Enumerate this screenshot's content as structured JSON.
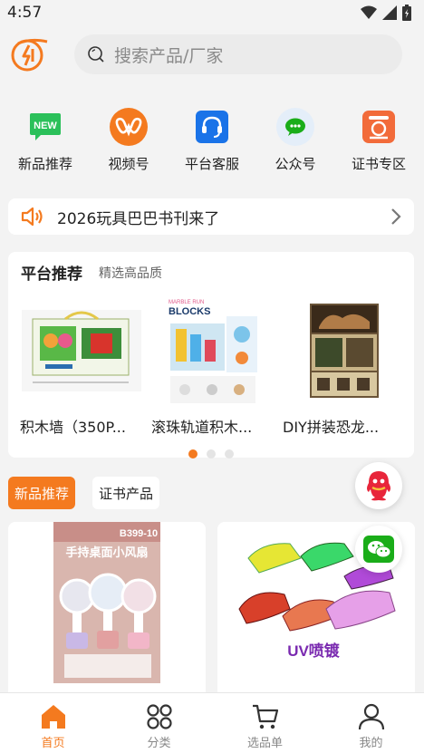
{
  "status_bar": {
    "time": "4:57"
  },
  "search": {
    "placeholder": "搜索产品/厂家"
  },
  "quick_links": [
    {
      "label": "新品推荐",
      "icon": "new-badge-icon",
      "badge": "NEW"
    },
    {
      "label": "视频号",
      "icon": "video-channel-icon"
    },
    {
      "label": "平台客服",
      "icon": "headset-icon"
    },
    {
      "label": "公众号",
      "icon": "wechat-icon"
    },
    {
      "label": "证书专区",
      "icon": "certificate-icon"
    }
  ],
  "notice": {
    "text": "2026玩具巴巴书刊来了"
  },
  "recommend": {
    "title": "平台推荐",
    "subtitle": "精选高品质",
    "products": [
      {
        "name": "积木墙（350P..."
      },
      {
        "name": "滚珠轨道积木..."
      },
      {
        "name": "DIY拼装恐龙..."
      }
    ]
  },
  "tabs": {
    "active": "新品推荐",
    "inactive": "证书产品"
  },
  "cards": [
    {
      "badge": "B399-10",
      "title": "手持桌面小风扇"
    },
    {
      "label": "UV喷镀"
    }
  ],
  "bottom_nav": [
    {
      "label": "首页",
      "icon": "home-icon",
      "active": true
    },
    {
      "label": "分类",
      "icon": "category-icon",
      "active": false
    },
    {
      "label": "选品单",
      "icon": "cart-icon",
      "active": false
    },
    {
      "label": "我的",
      "icon": "user-icon",
      "active": false
    }
  ],
  "colors": {
    "accent": "#f47a1f",
    "blue": "#1a73e8",
    "green": "#1aad19"
  }
}
